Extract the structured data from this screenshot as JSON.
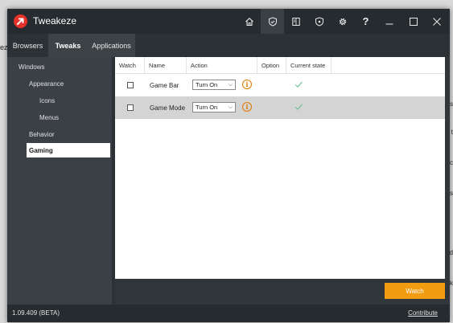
{
  "background": {
    "left_text": "eze",
    "right_texts": [
      "s",
      "t",
      "c",
      "s",
      "d",
      "k"
    ]
  },
  "app": {
    "title": "Tweakeze",
    "logo_color": "#e5322b"
  },
  "titlebar": {
    "buttons": [
      {
        "icon": "home-icon"
      },
      {
        "icon": "shield-icon",
        "active": true
      },
      {
        "icon": "book-icon"
      },
      {
        "icon": "shield-alt-icon"
      },
      {
        "icon": "gear-icon"
      },
      {
        "icon": "help-icon",
        "glyph": "?"
      },
      {
        "icon": "minimize-icon"
      },
      {
        "icon": "maximize-icon"
      },
      {
        "icon": "close-icon"
      }
    ]
  },
  "nav": {
    "tabs": [
      {
        "label": "Browsers"
      },
      {
        "label": "Tweaks",
        "selected": true
      },
      {
        "label": "Applications"
      }
    ]
  },
  "sidebar": {
    "items": [
      {
        "label": "Windows"
      },
      {
        "label": "Appearance"
      },
      {
        "label": "Icons"
      },
      {
        "label": "Menus"
      },
      {
        "label": "Behavior"
      },
      {
        "label": "Gaming",
        "selected": true
      }
    ]
  },
  "table": {
    "headers": [
      "Watch",
      "Name",
      "Action",
      "Option",
      "Current state"
    ],
    "rows": [
      {
        "name": "Game Bar",
        "action": "Turn On",
        "info": "i",
        "state_ok": true,
        "highlighted": false
      },
      {
        "name": "Game Mode",
        "action": "Turn On",
        "info": "i",
        "state_ok": true,
        "highlighted": true
      }
    ]
  },
  "watch_button": {
    "label": "Watch",
    "color": "#f39c12"
  },
  "statusbar": {
    "version": "1.09.409 (BETA)",
    "contribute": "Contribute"
  },
  "colors": {
    "accent": "#f39c12",
    "info": "#e07b00",
    "check": "#5fbf8f"
  }
}
